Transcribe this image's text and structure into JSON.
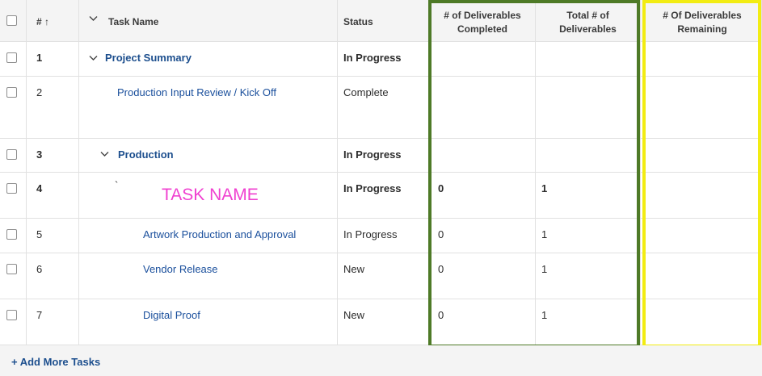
{
  "header": {
    "num_label": "# ↑",
    "task_name_label": "Task Name",
    "status_label": "Status",
    "deliverables_completed_line1": "# of Deliverables",
    "deliverables_completed_line2": "Completed",
    "total_deliverables_line1": "Total # of",
    "total_deliverables_line2": "Deliverables",
    "remaining_line1": "# Of Deliverables",
    "remaining_line2": "Remaining"
  },
  "rows": [
    {
      "num": "1",
      "name": "Project Summary",
      "status": "In Progress",
      "completed": "",
      "total": ""
    },
    {
      "num": "2",
      "name": "Production Input Review / Kick Off",
      "status": "Complete",
      "completed": "",
      "total": ""
    },
    {
      "num": "3",
      "name": "Production",
      "status": "In Progress",
      "completed": "",
      "total": ""
    },
    {
      "num": "4",
      "name": "`",
      "status": "In Progress",
      "completed": "0",
      "total": "1"
    },
    {
      "num": "5",
      "name": "Artwork Production and Approval",
      "status": "In Progress",
      "completed": "0",
      "total": "1"
    },
    {
      "num": "6",
      "name": "Vendor Release",
      "status": "New",
      "completed": "0",
      "total": "1"
    },
    {
      "num": "7",
      "name": "Digital Proof",
      "status": "New",
      "completed": "0",
      "total": "1"
    }
  ],
  "annotation": {
    "task_name_overlay": "TASK NAME"
  },
  "footer": {
    "add_more_label": "+ Add More Tasks"
  },
  "colors": {
    "green_highlight": "#4e7a27",
    "yellow_highlight": "#f2ec12",
    "link": "#1d4f8e",
    "annotation_pink": "#f040d0"
  },
  "icons": {
    "expand_header": "chevron-down-icon",
    "expand_row1": "chevron-down-icon",
    "expand_row3": "chevron-down-icon",
    "sort": "arrow-up-icon"
  }
}
